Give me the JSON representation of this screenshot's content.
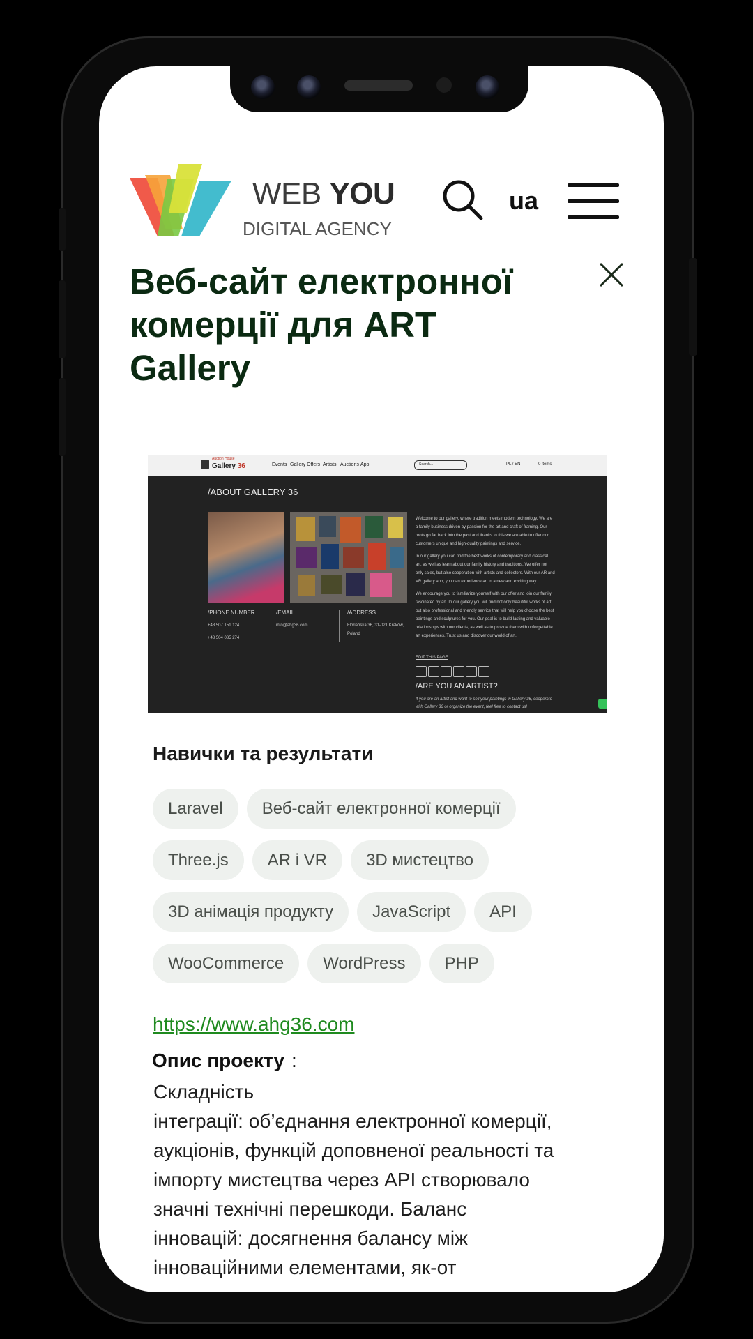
{
  "header": {
    "logo_line1_light": "WEB ",
    "logo_line1_bold": "YOU",
    "logo_line2": "DIGITAL AGENCY",
    "language": "ua"
  },
  "page": {
    "title": "Веб-сайт електронної комерції для ART Gallery"
  },
  "screenshot": {
    "site_brand_small": "Auction House",
    "site_brand": "Gallery",
    "site_brand_num": "36",
    "nav": [
      "Events",
      "Gallery Offers",
      "Artists",
      "Auctions",
      "App"
    ],
    "search_placeholder": "Search...",
    "lang_switch": "PL / EN",
    "cart": "0 items",
    "section_title": "/ABOUT GALLERY 36",
    "phone_label": "/PHONE NUMBER",
    "phone_1": "+48 507 151 124",
    "phone_2": "+48 504 085 274",
    "email_label": "/EMAIL",
    "email": "info@ahg36.com",
    "address_label": "/ADDRESS",
    "address_1": "Floriańska 36, 31-021 Kraków,",
    "address_2": "Poland",
    "para1": "Welcome to our gallery, where tradition meets modern technology. We are a family business driven by passion for the art and craft of framing. Our roots go far back into the past and thanks to this we are able to offer our customers unique and high-quality paintings and service.",
    "para2": "In our gallery you can find the best works of contemporary and classical art, as well as learn about our family history and traditions. We offer not only sales, but also cooperation with artists and collectors. With our AR and VR gallery app, you can experience art in a new and exciting way.",
    "para3": "We encourage you to familiarize yourself with our offer and join our family fascinated by art. In our gallery you will find not only beautiful works of art, but also professional and friendly service that will help you choose the best paintings and sculptures for you. Our goal is to build lasting and valuable relationships with our clients, as well as to provide them with unforgettable art experiences. Trust us and discover our world of art.",
    "edit_link": "EDIT THIS PAGE",
    "artist_title": "/ARE YOU AN ARTIST?",
    "artist_text": "If you are an artist and want to sell your paintings in Gallery 36, cooperate with Gallery 36 or organize the event, feel free to contact us!"
  },
  "skills": {
    "title": "Навички та результати",
    "tags": [
      "Laravel",
      "Веб-сайт електронної комерції",
      "Three.js",
      "AR і VR",
      "3D мистецтво",
      "3D анімація продукту",
      "JavaScript",
      "API",
      "WooCommerce",
      "WordPress",
      "PHP"
    ]
  },
  "project": {
    "url": "https://www.ahg36.com",
    "desc_label": "Опис проекту",
    "desc_colon": ":",
    "desc_lines": [
      "Складність",
      "інтеграції: об’єднання електронної комерції,",
      "аукціонів, функцій доповненої реальності та",
      "імпорту мистецтва через API створювало",
      "значні технічні перешкоди. Баланс",
      "інновацій: досягнення балансу між",
      "інноваційними елементами, як-от"
    ]
  },
  "colors": {
    "title": "#0b2a12",
    "link": "#1f8a1f",
    "tag_bg": "#eef1ee"
  }
}
